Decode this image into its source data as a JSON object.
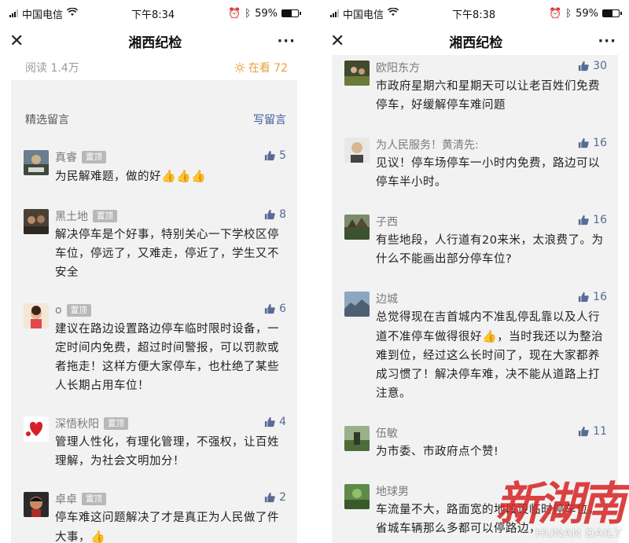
{
  "left": {
    "status": {
      "carrier": "中国电信",
      "time": "下午8:34",
      "battery": "59%",
      "battery_level": 0.59
    },
    "nav": {
      "title": "湘西纪检",
      "close_glyph": "✕",
      "more_glyph": "···"
    },
    "read_count": "阅读 1.4万",
    "watching": "在看 72",
    "section_title": "精选留言",
    "write_label": "写留言",
    "comments": [
      {
        "name": "真睿",
        "badge": "置顶",
        "likes": "5",
        "text": "为民解难题，做的好",
        "emoji": "👍👍👍"
      },
      {
        "name": "黑土地",
        "badge": "置顶",
        "likes": "8",
        "text": "解决停车是个好事，特别关心一下学校区停车位，停远了，又难走，停近了，学生又不安全"
      },
      {
        "name": "o",
        "badge": "置顶",
        "likes": "6",
        "text": "建议在路边设置路边停车临时限时设备，一定时间内免费，超过时间警报，可以罚款或者拖走！这样方便大家停车，也杜绝了某些人长期占用车位！"
      },
      {
        "name": "深悟秋阳",
        "badge": "置顶",
        "likes": "4",
        "text": "管理人性化，有理化管理，不强权，让百姓理解，为社会文明加分！"
      },
      {
        "name": "卓卓",
        "badge": "置顶",
        "likes": "2",
        "text": "停车难这问题解决了才是真正为人民做了件大事，",
        "emoji": "👍"
      }
    ]
  },
  "right": {
    "status": {
      "carrier": "中国电信",
      "time": "下午8:38",
      "battery": "59%",
      "battery_level": 0.59
    },
    "nav": {
      "title": "湘西纪检",
      "close_glyph": "✕",
      "more_glyph": "···"
    },
    "comments": [
      {
        "name": "欧阳东方",
        "likes": "30",
        "text": "市政府星期六和星期天可以让老百姓们免费停车，好缓解停车难问题"
      },
      {
        "name": "为人民服务！黄清先:",
        "likes": "16",
        "text": "见议！停车场停车一小时内免费，路边可以停车半小时。"
      },
      {
        "name": "子西",
        "likes": "16",
        "text": "有些地段，人行道有20来米，太浪费了。为什么不能画出部分停车位?"
      },
      {
        "name": "边城",
        "likes": "16",
        "text": "总觉得现在吉首城内不准乱停乱靠以及人行道不准停车做得很好",
        "emoji": "👍",
        "text2": "，当时我还以为整治难到位，经过这么长时间了，现在大家都养成习惯了！解决停车难，决不能从道路上打注意。"
      },
      {
        "name": "伍敏",
        "likes": "11",
        "text": "为市委、市政府点个赞!"
      },
      {
        "name": "地球男",
        "likes": "",
        "text": "车流量不大，路面宽的地段设临时停车位，省城车辆那么多都可以停路边，"
      }
    ]
  },
  "watermark": {
    "cn": "新湖南",
    "en": "HUNAN DAILY"
  },
  "colors": {
    "accent_blue": "#576b95",
    "watching_gold": "#e6a23c",
    "badge_gray": "#b8b8b8",
    "bg_gray": "#f2f2f2",
    "watermark_red": "#d62828"
  },
  "icons": {
    "like": "thumbs-up-icon",
    "watching": "sparkle-icon",
    "close": "close-icon",
    "more": "more-icon"
  }
}
